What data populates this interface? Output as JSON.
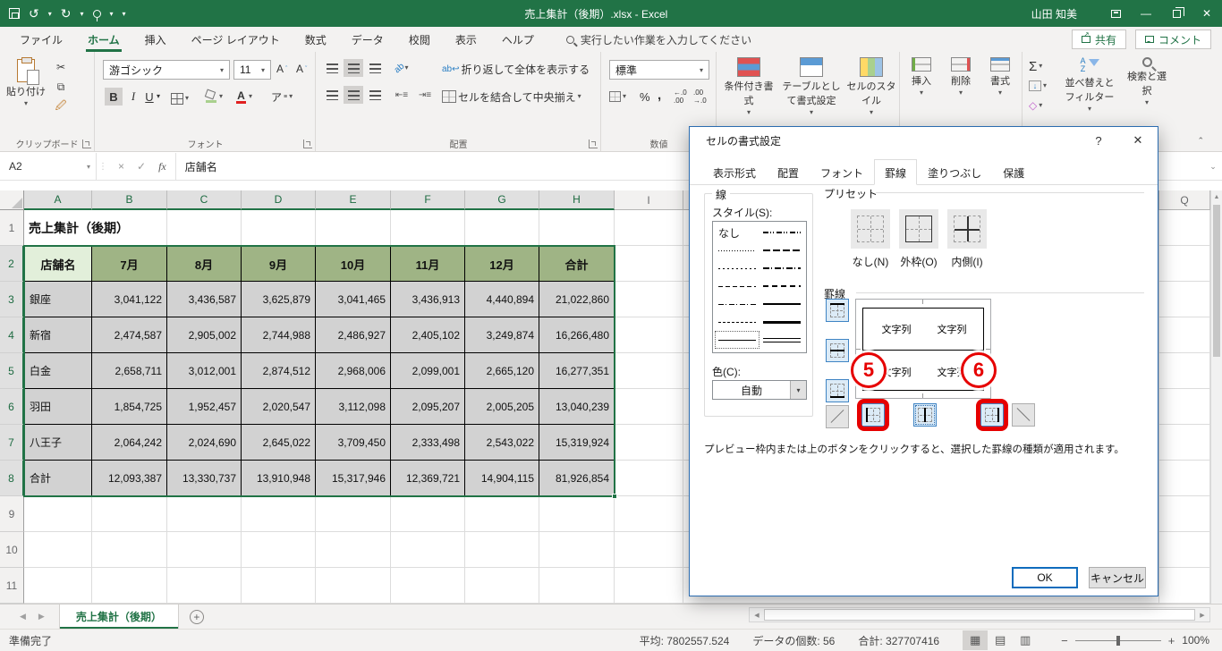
{
  "colors": {
    "excel-green": "#217346",
    "title-bar": "#217346",
    "annotation-red": "#e60000",
    "header-fill": "#9fb485",
    "active-cell-fill": "#e2efda",
    "selection-gray": "#d2d2d2",
    "dialog-accent": "#2b6cb0"
  },
  "titlebar": {
    "title": "売上集計（後期）.xlsx -  Excel",
    "user": "山田 知美"
  },
  "tabrow": {
    "tabs": [
      "ファイル",
      "ホーム",
      "挿入",
      "ページ レイアウト",
      "数式",
      "データ",
      "校閲",
      "表示",
      "ヘルプ"
    ],
    "active_index": 1,
    "search": "実行したい作業を入力してください",
    "share": "共有",
    "comments": "コメント"
  },
  "ribbon": {
    "clipboard": {
      "label": "クリップボード",
      "paste": "貼り付け"
    },
    "font": {
      "label": "フォント",
      "font_name": "游ゴシック",
      "font_size": "11"
    },
    "alignment": {
      "label": "配置",
      "wrap_text": "折り返して全体を表示する",
      "merge_center": "セルを結合して中央揃え"
    },
    "number": {
      "label": "数値",
      "format": "標準"
    },
    "styles": {
      "conditional": "条件付き書式",
      "format_table": "テーブルとして書式設定",
      "cell_styles": "セルのスタイル"
    },
    "cells": {
      "insert": "挿入",
      "delete": "削除",
      "format": "書式"
    },
    "editing": {
      "sort_filter": "並べ替えとフィルター",
      "find_select": "検索と選択"
    }
  },
  "formula_bar": {
    "name_box": "A2",
    "value": "店舗名"
  },
  "grid": {
    "col_headers": [
      "A",
      "B",
      "C",
      "D",
      "E",
      "F",
      "G",
      "H",
      "I"
    ],
    "far_col_header": "Q",
    "title": "売上集計（後期）",
    "table": {
      "header": [
        "店舗名",
        "7月",
        "8月",
        "9月",
        "10月",
        "11月",
        "12月",
        "合計"
      ],
      "rows": [
        [
          "銀座",
          "3,041,122",
          "3,436,587",
          "3,625,879",
          "3,041,465",
          "3,436,913",
          "4,440,894",
          "21,022,860"
        ],
        [
          "新宿",
          "2,474,587",
          "2,905,002",
          "2,744,988",
          "2,486,927",
          "2,405,102",
          "3,249,874",
          "16,266,480"
        ],
        [
          "白金",
          "2,658,711",
          "3,012,001",
          "2,874,512",
          "2,968,006",
          "2,099,001",
          "2,665,120",
          "16,277,351"
        ],
        [
          "羽田",
          "1,854,725",
          "1,952,457",
          "2,020,547",
          "3,112,098",
          "2,095,207",
          "2,005,205",
          "13,040,239"
        ],
        [
          "八王子",
          "2,064,242",
          "2,024,690",
          "2,645,022",
          "3,709,450",
          "2,333,498",
          "2,543,022",
          "15,319,924"
        ],
        [
          "合計",
          "12,093,387",
          "13,330,737",
          "13,910,948",
          "15,317,946",
          "12,369,721",
          "14,904,115",
          "81,926,854"
        ]
      ]
    }
  },
  "dialog": {
    "title": "セルの書式設定",
    "tabs": [
      "表示形式",
      "配置",
      "フォント",
      "罫線",
      "塗りつぶし",
      "保護"
    ],
    "active_tab_index": 3,
    "line_group": {
      "label": "線",
      "style_label": "スタイル(S):",
      "styles_left": [
        {
          "label": "なし",
          "type": "none"
        },
        {
          "type": "dot-fine"
        },
        {
          "type": "dot"
        },
        {
          "type": "dash-sm"
        },
        {
          "type": "dash-dot"
        },
        {
          "type": "dash-fine"
        },
        {
          "type": "solid-thin",
          "selected": true
        }
      ],
      "styles_right": [
        {
          "type": "dash-dot-dot"
        },
        {
          "type": "dash-wide"
        },
        {
          "type": "dash-dot-med"
        },
        {
          "type": "dash-med"
        },
        {
          "type": "solid-med"
        },
        {
          "type": "solid-thick"
        },
        {
          "type": "double"
        }
      ],
      "color_label": "色(C):",
      "color_value": "自動"
    },
    "presets": {
      "label": "プリセット",
      "items": [
        {
          "key": "none",
          "label": "なし(N)"
        },
        {
          "key": "outline",
          "label": "外枠(O)"
        },
        {
          "key": "inside",
          "label": "内側(I)"
        }
      ]
    },
    "border": {
      "label": "罫線",
      "preview_text": "文字列",
      "badge5": "5",
      "badge6": "6",
      "buttons_left": [
        {
          "name": "top-border",
          "state": "active"
        },
        {
          "name": "inner-horizontal-border",
          "state": "active"
        },
        {
          "name": "bottom-border",
          "state": "active"
        },
        {
          "name": "diagonal-up-border",
          "state": "normal"
        }
      ],
      "buttons_bottom": [
        {
          "name": "left-border",
          "state": "active",
          "annotated": true
        },
        {
          "name": "inner-vertical-border",
          "state": "focused"
        },
        {
          "name": "right-border",
          "state": "active",
          "annotated": true
        },
        {
          "name": "diagonal-down-border",
          "state": "normal"
        }
      ],
      "description": "プレビュー枠内または上のボタンをクリックすると、選択した罫線の種類が適用されます。"
    },
    "ok": "OK",
    "cancel": "キャンセル"
  },
  "sheet_tabs": {
    "active": "売上集計（後期）"
  },
  "status_bar": {
    "ready": "準備完了",
    "average": "平均: 7802557.524",
    "count": "データの個数: 56",
    "sum": "合計: 327707416",
    "zoom": "100%"
  }
}
